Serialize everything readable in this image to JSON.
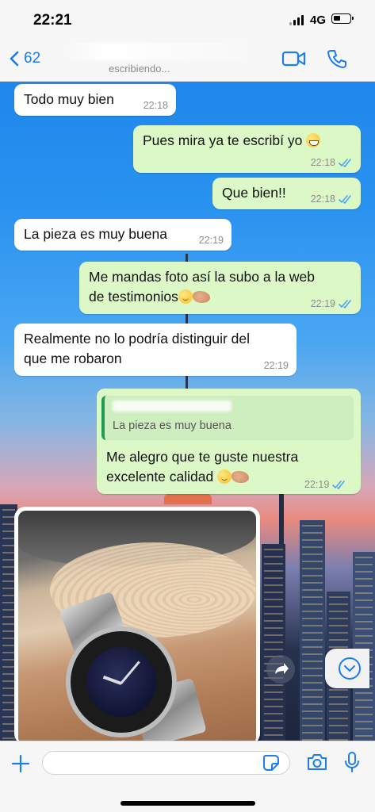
{
  "status_bar": {
    "time": "22:21",
    "network": "4G"
  },
  "header": {
    "back_count": "62",
    "subtitle": "escribiendo...",
    "icons": {
      "back": "chevron-left-icon",
      "video": "video-camera-icon",
      "call": "phone-icon"
    }
  },
  "colors": {
    "accent": "#1c7cf2",
    "outgoing_bubble": "#dcf8c6",
    "incoming_bubble": "#ffffff",
    "read_ticks": "#4fa3f7"
  },
  "messages": [
    {
      "direction": "in",
      "text": "Todo muy bien",
      "time": "22:18"
    },
    {
      "direction": "out",
      "text": "Pues mira ya te escribí yo",
      "emoji": "grinning-face",
      "time": "22:18",
      "status": "read"
    },
    {
      "direction": "out",
      "text": "Que bien!!",
      "time": "22:18",
      "status": "read"
    },
    {
      "direction": "in",
      "text": "La pieza es muy buena",
      "time": "22:19"
    },
    {
      "direction": "out",
      "text_line1": "Me mandas foto así la subo a la web",
      "text_line2": "de testimonios",
      "emoji": [
        "slightly-smiling-face",
        "handshake"
      ],
      "time": "22:19",
      "status": "read"
    },
    {
      "direction": "in",
      "text_line1": "Realmente no lo podría distinguir del",
      "text_line2": "que me robaron",
      "time": "22:19"
    },
    {
      "direction": "out",
      "quoted_text": "La pieza es muy buena",
      "text_line1": "Me alegro que te guste nuestra",
      "text_line2": "excelente calidad",
      "emoji": [
        "slightly-smiling-face",
        "handshake"
      ],
      "time": "22:19",
      "status": "read"
    },
    {
      "direction": "in",
      "type": "image",
      "image_content": "wristwatch-photo"
    }
  ],
  "input_bar": {
    "placeholder": "",
    "icons": {
      "add": "plus-icon",
      "sticker": "sticker-icon",
      "camera": "camera-icon",
      "mic": "microphone-icon"
    }
  },
  "floating": {
    "share": "share-arrow-icon",
    "scroll_down": "chevron-down-circle-icon"
  }
}
